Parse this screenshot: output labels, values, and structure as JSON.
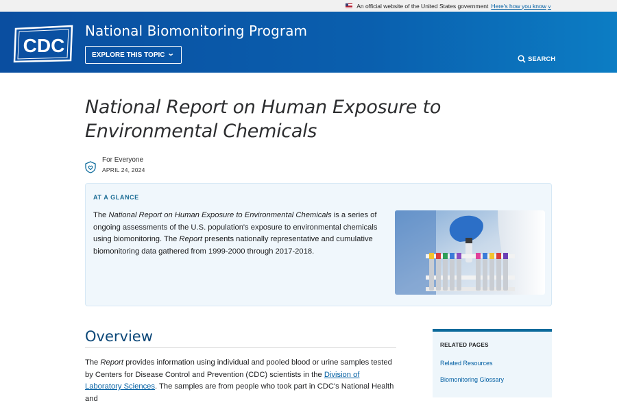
{
  "gov_banner": {
    "text": "An official website of the United States government",
    "link": "Here's how you know"
  },
  "header": {
    "logo_text": "CDC",
    "program_title": "National Biomonitoring Program",
    "explore_label": "EXPLORE THIS TOPIC",
    "search_label": "SEARCH",
    "colors": {
      "header_start": "#0a4ea0",
      "header_end": "#0c7dc4"
    }
  },
  "page": {
    "title": "National Report on Human Exposure to Environmental Chemicals",
    "audience": "For Everyone",
    "date": "APRIL 24, 2024"
  },
  "glance": {
    "heading": "AT A GLANCE",
    "text_1": "The ",
    "text_italic_1": "National Report on Human Exposure to Environmental Chemicals",
    "text_2": " is a series of ongoing assessments of the U.S. population's exposure to environmental chemicals using biomonitoring. The ",
    "text_italic_2": "Report",
    "text_3": " presents nationally representative and cumulative biomonitoring data gathered from 1999-2000 through 2017-2018."
  },
  "overview": {
    "title": "Overview",
    "text_1": "The ",
    "text_italic_1": "Report",
    "text_2": " provides information using individual and pooled blood or urine samples tested by Centers for Disease Control and Prevention (CDC) scientists in the ",
    "link": "Division of Laboratory Sciences",
    "text_3": ". The samples are from people who took part in CDC's National Health and"
  },
  "related": {
    "heading": "RELATED PAGES",
    "links": [
      "Related Resources",
      "Biomonitoring Glossary"
    ]
  },
  "icons": [
    "us-flag-icon",
    "chevron-down-icon",
    "search-icon",
    "shield-heart-icon"
  ]
}
